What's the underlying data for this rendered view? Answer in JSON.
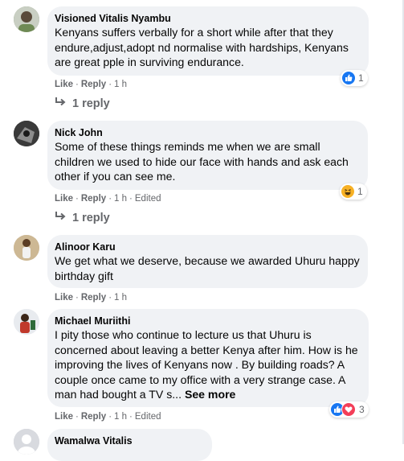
{
  "comments": [
    {
      "author": "Visioned Vitalis Nyambu",
      "text": "Kenyans suffers verbally for a short while after that they endure,adjust,adopt nd normalise with hardships, Kenyans are great pple in surviving endurance.",
      "like": "Like",
      "reply": "Reply",
      "time": "1 h",
      "reactions": {
        "icons": [
          "like-icon"
        ],
        "count": "1"
      },
      "replies_label": "1 reply"
    },
    {
      "author": "Nick John",
      "text": "Some of these things reminds me when we are small children we used to hide our face with hands and ask each other if you can see me.",
      "like": "Like",
      "reply": "Reply",
      "time": "1 h",
      "edited": "Edited",
      "reactions": {
        "icons": [
          "haha-icon"
        ],
        "count": "1"
      },
      "replies_label": "1 reply"
    },
    {
      "author": "Alinoor Karu",
      "text": "We get what we deserve, because we awarded Uhuru happy birthday gift",
      "like": "Like",
      "reply": "Reply",
      "time": "1 h"
    },
    {
      "author": "Michael Muriithi",
      "text": "I pity those who continue to lecture us that Uhuru is concerned about leaving a better Kenya after him. How is he improving the lives of Kenyans now . By building roads? A couple once came to my office with a very strange case. A man had bought a TV s...",
      "see_more": "See more",
      "like": "Like",
      "reply": "Reply",
      "time": "1 h",
      "edited": "Edited",
      "reactions": {
        "icons": [
          "like-icon",
          "love-icon"
        ],
        "count": "3"
      }
    },
    {
      "author": "Wamalwa Vitalis"
    }
  ],
  "colors": {
    "like_blue": "#1877f2",
    "love_red": "#f33e58",
    "haha_yellow": "#f7b125",
    "meta_gray": "#65676b",
    "bubble": "#f0f2f5"
  }
}
